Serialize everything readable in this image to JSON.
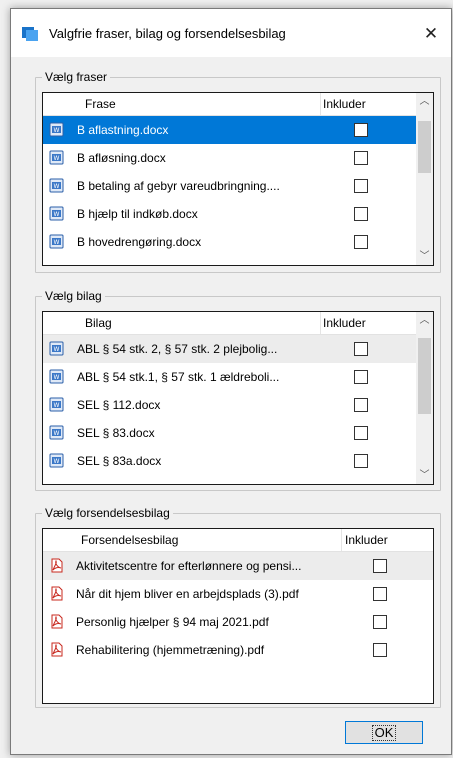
{
  "window": {
    "title": "Valgfrie fraser, bilag og forsendelsesbilag",
    "close_glyph": "✕",
    "ok_label": "OK"
  },
  "fraser": {
    "group_label": "Vælg fraser",
    "col_name": "Frase",
    "col_include": "Inkluder",
    "icon": "word-doc-icon",
    "items": [
      {
        "label": "B aflastning.docx",
        "checked": false,
        "selected": true
      },
      {
        "label": "B afløsning.docx",
        "checked": false
      },
      {
        "label": "B betaling af gebyr vareudbringning....",
        "checked": false
      },
      {
        "label": "B hjælp til indkøb.docx",
        "checked": false
      },
      {
        "label": "B hovedrengøring.docx",
        "checked": false
      }
    ]
  },
  "bilag": {
    "group_label": "Vælg bilag",
    "col_name": "Bilag",
    "col_include": "Inkluder",
    "icon": "word-doc-icon",
    "items": [
      {
        "label": "ABL § 54  stk. 2, § 57 stk. 2 plejbolig...",
        "checked": false,
        "hover": true
      },
      {
        "label": "ABL § 54 stk.1, § 57 stk. 1 ældreboli...",
        "checked": false
      },
      {
        "label": "SEL § 112.docx",
        "checked": false
      },
      {
        "label": "SEL § 83.docx",
        "checked": false
      },
      {
        "label": "SEL § 83a.docx",
        "checked": false
      }
    ]
  },
  "forsendelsesbilag": {
    "group_label": "Vælg forsendelsesbilag",
    "col_name": "Forsendelsesbilag",
    "col_include": "Inkluder",
    "icon": "pdf-icon",
    "items": [
      {
        "label": "Aktivitetscentre for efterlønnere og pensi...",
        "checked": false,
        "hover": true
      },
      {
        "label": "Når dit hjem bliver en arbejdsplads (3).pdf",
        "checked": false
      },
      {
        "label": "Personlig hjælper § 94 maj 2021.pdf",
        "checked": false
      },
      {
        "label": "Rehabilitering (hjemmetræning).pdf",
        "checked": false
      }
    ]
  },
  "colors": {
    "accent": "#0078d7",
    "hover_row": "#ececec"
  }
}
